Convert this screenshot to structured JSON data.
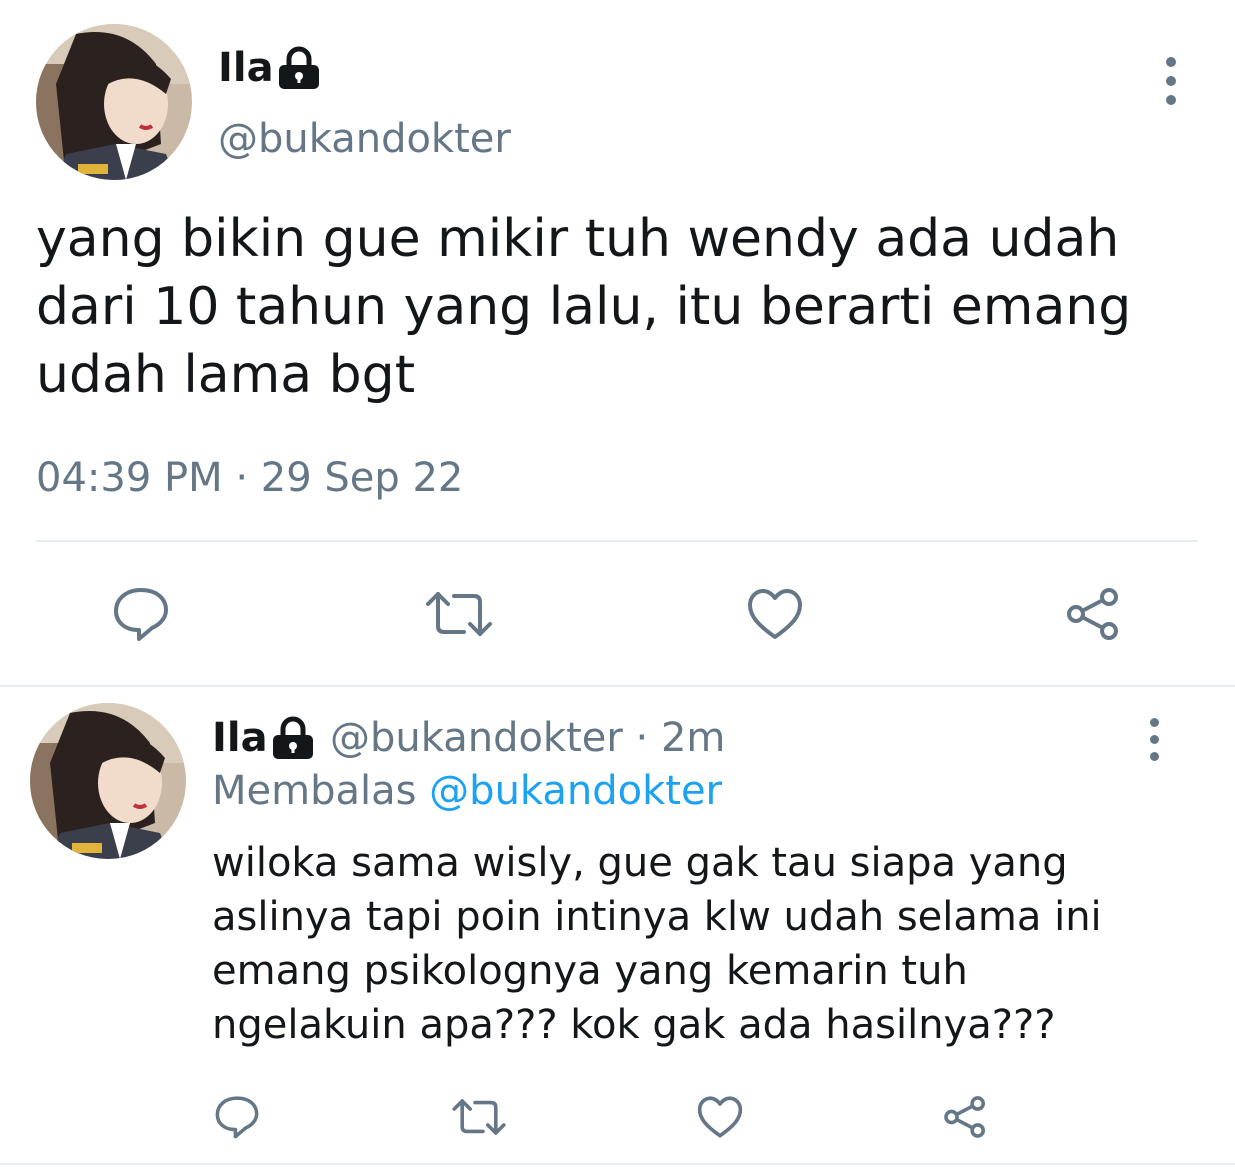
{
  "main_tweet": {
    "author_name": "Ila",
    "handle": "@bukandokter",
    "text_lines": [
      "yang bikin gue mikir tuh wendy ada udah",
      "dari 10 tahun yang lalu, itu berarti emang",
      "udah lama bgt"
    ],
    "timestamp": "04:39 PM · 29 Sep 22"
  },
  "reply_tweet": {
    "author_name": "Ila",
    "handle_time": "@bukandokter · 2m",
    "replying_label": "Membalas",
    "replying_to": "@bukandokter",
    "text_lines": [
      "wiloka sama wisly, gue gak tau siapa yang",
      "aslinya tapi poin intinya klw udah selama ini",
      "emang psikolognya yang kemarin tuh",
      "ngelakuin apa??? kok gak ada hasilnya???"
    ]
  },
  "icons": [
    "lock-icon",
    "more-options-icon",
    "reply-icon",
    "retweet-icon",
    "like-icon",
    "share-icon"
  ],
  "colors": {
    "text": "#14171a",
    "muted": "#657786",
    "link": "#1da1f2",
    "divider": "#e6ecf0"
  }
}
